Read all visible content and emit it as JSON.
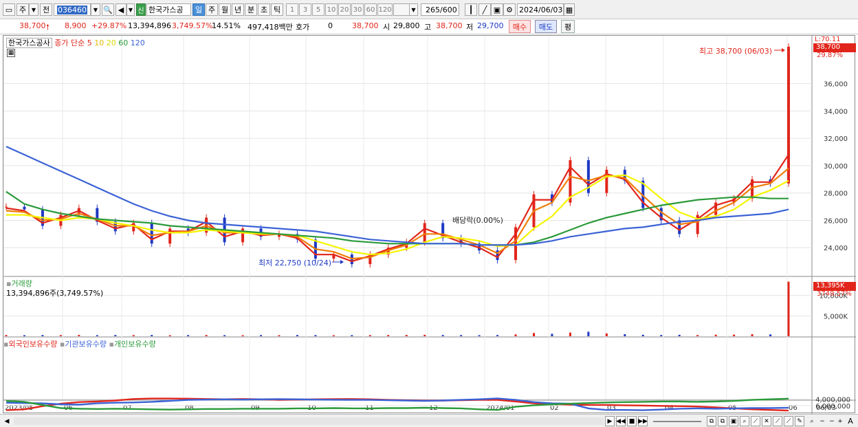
{
  "toolbar": {
    "market": "주",
    "prefix": "전",
    "code": "036460",
    "badge": "신",
    "stock_name": "한국가스공",
    "periods": [
      "일",
      "주",
      "월",
      "년",
      "분",
      "초",
      "틱"
    ],
    "selected_period": "일",
    "intervals": [
      "1",
      "3",
      "5",
      "10",
      "20",
      "30",
      "60",
      "120"
    ],
    "count": "265",
    "count_max": "/600",
    "date": "2024/06/03"
  },
  "quote": {
    "price": "38,700",
    "change": "8,900",
    "change_pct": "+29.87%",
    "volume": "13,394,896",
    "volume_pct": "3,749.57%",
    "turnover": "14.51%",
    "amount": "497,418백만",
    "hoga_label": "호가",
    "hoga_value": "0",
    "hoga_price": "38,700",
    "open_label": "시",
    "open": "29,800",
    "high_label": "고",
    "high": "38,700",
    "low_label": "저",
    "low": "29,700",
    "buy_label": "매수",
    "sell_label": "매도",
    "extra_label": "평"
  },
  "colors": {
    "up": "#e1251b",
    "down": "#1d39c4",
    "ma5": "#e1251b",
    "ma10": "#f07d0a",
    "ma20": "#f5f500",
    "ma60": "#2a9a3a",
    "ma120": "#3b62d6",
    "foreign": "#e1251b",
    "institution": "#3b62d6",
    "individual": "#2a9a3a"
  },
  "price_panel": {
    "legend_name": "한국가스공사",
    "legend_ma": "종가 단순",
    "ma_periods": [
      "5",
      "10",
      "20",
      "60",
      "120"
    ],
    "top_right_small": "L:70.11",
    "last_price_tag": "38,700",
    "last_pct_tag": "29.87%",
    "high_annotation": "최고 38,700 (06/03)",
    "low_annotation": "최저 22,750 (10/24)",
    "dividend_annotation": "배당락(0.00%)"
  },
  "volume_panel": {
    "title": "거래량",
    "value": "13,394,896주(3,749.57%)",
    "tag_value": "13,395K",
    "tag_pct": "3749.57%",
    "tag_under": "10,000K"
  },
  "holding_panel": {
    "labels": [
      "외국인보유수량",
      "기관보유수량",
      "개인보유수량"
    ]
  },
  "chart_data": [
    {
      "type": "line",
      "name": "price",
      "y_ticks": [
        "36,000",
        "34,000",
        "32,000",
        "30,000",
        "28,000",
        "26,000",
        "24,000"
      ],
      "ylim": [
        22000,
        39200
      ],
      "x_ticks": [
        "2023/05",
        "06",
        "07",
        "08",
        "09",
        "10",
        "11",
        "12",
        "2024/01",
        "02",
        "03",
        "04",
        "05",
        "06",
        "06/03"
      ],
      "series": [
        {
          "name": "종가",
          "values": [
            27000,
            26800,
            25600,
            26400,
            26900,
            25900,
            25200,
            25800,
            24300,
            25400,
            25100,
            26200,
            24400,
            25400,
            24800,
            25000,
            24600,
            23200,
            23500,
            22800,
            23500,
            24000,
            24400,
            25800,
            24700,
            24300,
            23800,
            23100,
            25500,
            27900,
            27300,
            30400,
            28000,
            29700,
            28900,
            26900,
            26000,
            25000,
            26400,
            27300,
            27600,
            29000,
            28700,
            38700
          ]
        },
        {
          "name": "5",
          "values": [
            26900,
            26700,
            25800,
            26200,
            26700,
            26000,
            25400,
            25700,
            24600,
            25200,
            25200,
            25900,
            24800,
            25200,
            24900,
            25000,
            24700,
            23500,
            23500,
            23000,
            23400,
            23900,
            24300,
            25400,
            24900,
            24400,
            24000,
            23300,
            25000,
            27500,
            27500,
            29900,
            28600,
            29400,
            29000,
            27300,
            26200,
            25300,
            26100,
            27100,
            27500,
            28800,
            28800,
            30800
          ]
        },
        {
          "name": "10",
          "values": [
            26700,
            26600,
            26000,
            26100,
            26500,
            26100,
            25600,
            25600,
            24900,
            25100,
            25200,
            25600,
            25100,
            25100,
            25000,
            25000,
            24800,
            23900,
            23700,
            23200,
            23300,
            23800,
            24200,
            25000,
            25000,
            24600,
            24200,
            23600,
            24500,
            26700,
            27300,
            29200,
            28900,
            29300,
            29100,
            27800,
            26600,
            25700,
            25900,
            26700,
            27300,
            28400,
            28700,
            29800
          ]
        },
        {
          "name": "20",
          "values": [
            26400,
            26400,
            26200,
            26000,
            26200,
            26100,
            25800,
            25600,
            25300,
            25100,
            25100,
            25300,
            25200,
            25100,
            25000,
            25000,
            24900,
            24500,
            24100,
            23700,
            23500,
            23600,
            23900,
            24400,
            24800,
            24700,
            24500,
            24100,
            24200,
            25400,
            26300,
            27700,
            28400,
            29200,
            29300,
            28700,
            27600,
            26600,
            26100,
            26300,
            26800,
            27700,
            28200,
            28900
          ]
        },
        {
          "name": "60",
          "values": [
            28100,
            27200,
            26800,
            26500,
            26300,
            26100,
            26000,
            25900,
            25800,
            25600,
            25500,
            25400,
            25300,
            25200,
            25100,
            25000,
            24900,
            24800,
            24700,
            24500,
            24400,
            24300,
            24300,
            24300,
            24300,
            24300,
            24200,
            24200,
            24200,
            24400,
            24800,
            25300,
            25800,
            26200,
            26500,
            26800,
            27100,
            27300,
            27500,
            27600,
            27700,
            27700,
            27600,
            27600
          ]
        },
        {
          "name": "120",
          "values": [
            31400,
            30800,
            30200,
            29600,
            29000,
            28400,
            27800,
            27200,
            26700,
            26300,
            26000,
            25800,
            25700,
            25600,
            25500,
            25400,
            25300,
            25200,
            25000,
            24800,
            24600,
            24500,
            24400,
            24300,
            24300,
            24300,
            24200,
            24200,
            24200,
            24300,
            24500,
            24800,
            25000,
            25200,
            25400,
            25500,
            25700,
            25900,
            26000,
            26200,
            26300,
            26400,
            26500,
            26800
          ]
        }
      ]
    },
    {
      "type": "bar",
      "name": "volume",
      "y_ticks": [
        "10,000K",
        "5,000K"
      ],
      "ylim": [
        0,
        14000
      ],
      "values": [
        300,
        250,
        300,
        280,
        320,
        260,
        300,
        280,
        300,
        250,
        280,
        300,
        260,
        250,
        280,
        260,
        300,
        280,
        250,
        260,
        280,
        300,
        320,
        350,
        300,
        280,
        260,
        300,
        450,
        800,
        600,
        900,
        1100,
        700,
        500,
        350,
        300,
        350,
        300,
        380,
        400,
        500,
        450,
        13395
      ]
    },
    {
      "type": "line",
      "name": "holdings",
      "y_ticks": [
        "6,000,000",
        "4,000,000"
      ],
      "ylim": [
        3400000,
        7800000
      ],
      "series": [
        {
          "name": "외국인보유수량",
          "values": [
            7500000,
            7200000,
            6200000,
            5400000,
            4900000,
            4700000,
            4400000,
            3900000,
            3750000,
            3750000,
            3800000,
            3900000,
            4000000,
            3900000,
            4000000,
            4200000,
            4100000,
            4000000,
            3950000,
            3900000,
            4000000,
            4200000,
            4300000,
            4400000,
            4400000,
            4300000,
            4200000,
            4200000,
            4700000,
            5300000,
            5500000,
            5700000,
            5800000,
            5800000,
            5900000,
            6000000,
            6100000,
            6200000,
            6300000,
            6600000,
            6900000,
            7200000,
            7400000,
            7600000
          ]
        },
        {
          "name": "기관보유수량",
          "values": [
            5100000,
            5200000,
            5300000,
            5600000,
            5700000,
            5300000,
            5100000,
            5000000,
            4800000,
            4500000,
            4200000,
            4100000,
            4000000,
            4100000,
            4000000,
            3950000,
            4000000,
            4100000,
            4150000,
            4200000,
            4200000,
            4300000,
            4400000,
            4500000,
            4400000,
            4200000,
            4000000,
            3700000,
            4200000,
            4900000,
            5300000,
            5400000,
            6900000,
            7400000,
            7400000,
            7500000,
            7300000,
            7000000,
            6900000,
            7000000,
            6900000,
            6800000,
            6800000,
            6700000
          ]
        },
        {
          "name": "개인보유수량",
          "values": [
            4500000,
            4800000,
            5800000,
            6800000,
            7000000,
            7100000,
            7000000,
            7100000,
            7200000,
            7300000,
            7200000,
            7100000,
            7100000,
            7000000,
            7000000,
            7000000,
            6900000,
            6900000,
            6800000,
            6900000,
            6900000,
            6800000,
            6800000,
            6700000,
            6800000,
            6900000,
            7200000,
            7400000,
            6400000,
            5900000,
            5600000,
            5400000,
            5200000,
            5000000,
            4900000,
            4800000,
            4700000,
            4700000,
            4800000,
            4700000,
            4500000,
            4200000,
            4000000,
            3800000
          ]
        }
      ]
    }
  ]
}
